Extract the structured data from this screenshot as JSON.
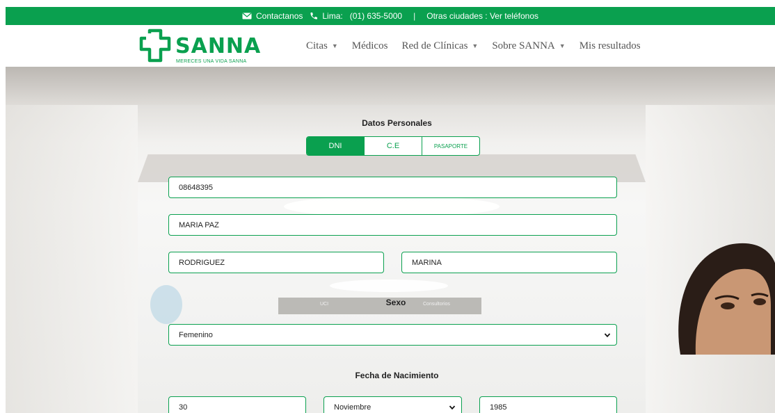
{
  "topbar": {
    "contact_label": "Contactanos",
    "lima_label": "Lima:",
    "lima_phone": "(01) 635-5000",
    "separator": "|",
    "other_cities": "Otras ciudades : Ver teléfonos"
  },
  "brand": {
    "name": "SANNA",
    "tagline": "MERECES UNA VIDA SANNA",
    "color": "#0aa04f"
  },
  "nav": {
    "items": [
      {
        "label": "Citas",
        "has_dropdown": true
      },
      {
        "label": "Médicos",
        "has_dropdown": false
      },
      {
        "label": "Red de Clínicas",
        "has_dropdown": true
      },
      {
        "label": "Sobre SANNA",
        "has_dropdown": true
      },
      {
        "label": "Mis resultados",
        "has_dropdown": false
      }
    ],
    "caret": "▼"
  },
  "hero_sign": {
    "left": "UCI",
    "right": "Consultorios"
  },
  "form": {
    "section_title": "Datos Personales",
    "doc_types": [
      "DNI",
      "C.E",
      "PASAPORTE"
    ],
    "doc_type_selected": "DNI",
    "document_number": "08648395",
    "names": "MARIA PAZ",
    "last_name_1": "RODRIGUEZ",
    "last_name_2": "MARINA",
    "sex_label": "Sexo",
    "sex_value": "Femenino",
    "birth_label": "Fecha de Nacimiento",
    "birth_day": "30",
    "birth_month": "Noviembre",
    "birth_year": "1985"
  }
}
